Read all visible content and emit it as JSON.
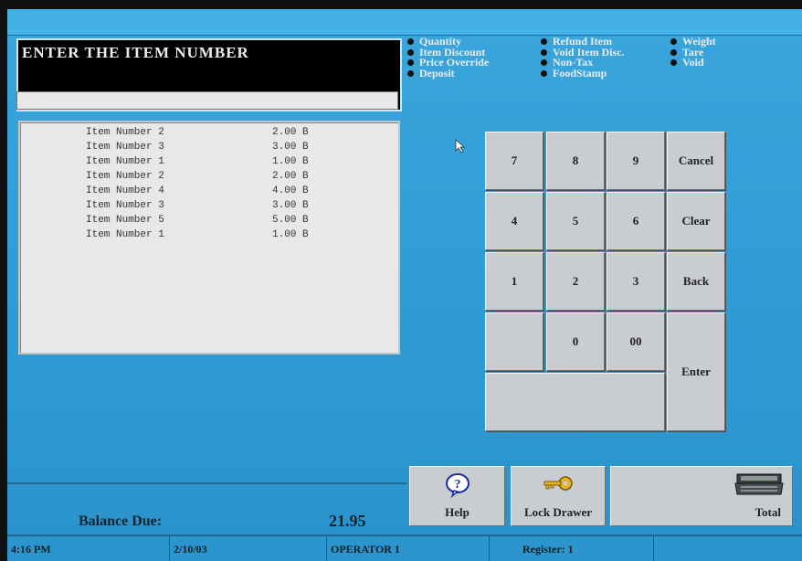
{
  "prompt": {
    "title": "ENTER THE ITEM NUMBER",
    "entry_value": ""
  },
  "functions": {
    "col1": [
      "Quantity",
      "Item Discount",
      "Price Override",
      "Deposit"
    ],
    "col2": [
      "Refund Item",
      "Void Item Disc.",
      "Non-Tax",
      "FoodStamp"
    ],
    "col3": [
      "Weight",
      "Tare",
      "Void"
    ]
  },
  "items": [
    {
      "name": "Item Number 2",
      "price": "2.00 B"
    },
    {
      "name": "Item Number 3",
      "price": "3.00 B"
    },
    {
      "name": "Item Number 1",
      "price": "1.00 B"
    },
    {
      "name": "Item Number 2",
      "price": "2.00 B"
    },
    {
      "name": "Item Number 4",
      "price": "4.00 B"
    },
    {
      "name": "Item Number 3",
      "price": "3.00 B"
    },
    {
      "name": "Item Number 5",
      "price": "5.00 B"
    },
    {
      "name": "Item Number 1",
      "price": "1.00 B"
    }
  ],
  "keypad": {
    "k7": "7",
    "k8": "8",
    "k9": "9",
    "cancel": "Cancel",
    "k4": "4",
    "k5": "5",
    "k6": "6",
    "clear": "Clear",
    "k1": "1",
    "k2": "2",
    "k3": "3",
    "back": "Back",
    "k0": "0",
    "k00": "00",
    "enter": "Enter"
  },
  "buttons": {
    "help": "Help",
    "lock_drawer": "Lock Drawer",
    "total": "Total"
  },
  "balance": {
    "label": "Balance Due:",
    "value": "21.95"
  },
  "status": {
    "time": "4:16 PM",
    "date": "2/10/03",
    "operator": "OPERATOR 1",
    "register": "Register: 1"
  }
}
